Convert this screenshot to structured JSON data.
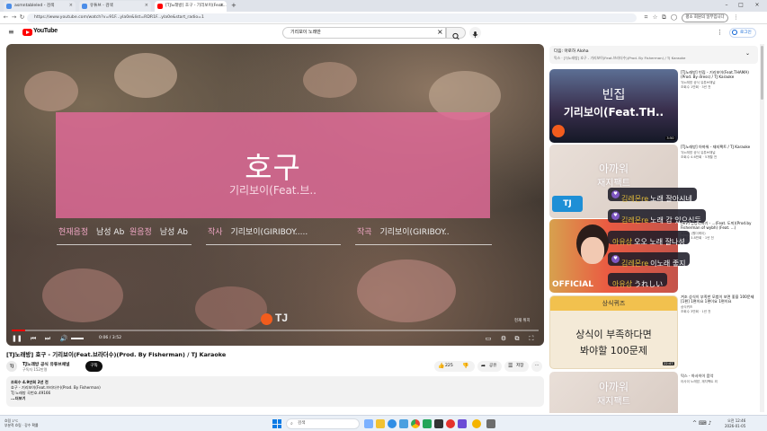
{
  "browser": {
    "tabs": [
      {
        "label": "asmntableled - 검색",
        "favicon_color": "#4b8de8",
        "active": false
      },
      {
        "label": "유튜브 - 검색",
        "favicon_color": "#4b8de8",
        "active": false
      },
      {
        "label": "[TJ노래방] 호구 - 기리보이(Feat...",
        "favicon_color": "#ff0000",
        "active": true
      }
    ],
    "new_tab_label": "+",
    "url": "https://www.youtube.com/watch?v=91F...yla0e&list=RDR1F...yla0e&start_radio=1",
    "profile_label": "평소 회원의 일부입니다"
  },
  "youtube": {
    "logo_text": "YouTube",
    "search_value": "기리보이 노래만",
    "login_label": "로그인"
  },
  "player": {
    "song_title": "호구",
    "song_artist": "기리보이(Feat.브..",
    "current_key_label": "현재음정",
    "current_key_value": "남성 Ab",
    "original_key_label": "원음정",
    "original_key_value": "남성 Ab",
    "lyricist_label": "작사",
    "lyricist_value": "기리보이(GIRIBOY.....",
    "composer_label": "작곡",
    "composer_value": "기리보이(GIRIBOY..",
    "brand": "TJ",
    "corner_label": "현재 위치",
    "time": "0:06 / 3:52",
    "progress_fraction": 0.026
  },
  "video": {
    "title": "[TJ노래방] 호구 - 기리보이(Feat.브라더수)(Prod. By Fisherman) / TJ Karaoke",
    "channel_avatar": "TJ",
    "channel_name": "TJ노래방 공식 유튜브채널",
    "channel_subs": "구독자 152만명",
    "subscribe_label": "구독",
    "like_count": "225",
    "share_label": "공유",
    "save_label": "저장",
    "description": [
      "조회수 4.9만회  2년 전",
      "호구 - 기리보이(Feat.브라더수)(Prod. By Fisherman)",
      "TJ 노래방 곡번호.49166",
      "...더보기"
    ]
  },
  "sidebar": {
    "up_next_title": "다음: 아로하 Aloha",
    "up_next_sub": "믹스 · [TJ노래방] 호구 - 기리보이(Feat.브라더수)(Prod. By Fisherman) / TJ Karaoke",
    "cards": [
      {
        "title": "[TJ노래방] 빈집 - 기리보이(Feat.THAMA)(Prod. By dress) / TJ Karaoke",
        "channel": "TJ노래방 공식 유튜브채널",
        "stats": "조회수 1만회 · 3년 전",
        "thumb_line1": "빈집",
        "thumb_line2": "기리보이(Feat.TH..",
        "duration": "3:50"
      },
      {
        "title": "[TJ노래방] 아까워 - 재지팩트 / TJ Karaoke",
        "channel": "TJ노래방 공식 유튜브채널",
        "stats": "조회수 4.6만회 · 5개월 전",
        "thumb_line1": "아까워",
        "thumb_line2": "재지팩트",
        "duration": ""
      },
      {
        "title": "[MV] 상상더하기 - ...(Feat. 도끼)(Prod.by Fisherman of wybh) (Feat. ...)",
        "channel": "1theK (원더케이)",
        "stats": "조회수 3.8만회 · 1년 전",
        "thumb_line1": "OFFICIAL",
        "thumb_line2": "",
        "duration": ""
      },
      {
        "title": "겨조 상식이 부족한 모범이 보면 좋을 100문제 [1편] 1편이요 1편이요 1편이요",
        "channel": "상식퀴즈",
        "stats": "조회수 3만회 · 1년 전",
        "thumb_line1": "상식이 부족하다면",
        "thumb_line2": "봐야할 100문제",
        "thumb_tag": "상식퀴즈",
        "duration": "22:47"
      },
      {
        "title": "믹스 - 아사이이 음악",
        "channel": "아사이 노래방, 재지팩트 외",
        "stats": "",
        "thumb_line1": "아까워",
        "thumb_line2": "재지팩트",
        "duration": ""
      }
    ]
  },
  "chat": [
    {
      "nick": "김레몬re",
      "msg": "노래 잘아시네",
      "heart": true
    },
    {
      "nick": "김레몬re",
      "msg": "노래 감 있으신듯",
      "heart": true
    },
    {
      "nick": "아유상",
      "msg": "오오 노래 잘나셩",
      "heart": false
    },
    {
      "nick": "김레몬re",
      "msg": "이노래 좋지",
      "heart": true
    },
    {
      "nick": "아유상",
      "msg": "うれしい",
      "heart": false
    }
  ],
  "taskbar": {
    "weather_line1": "흐림 1°C",
    "weather_line2": "부분적 흐림 · 강수 확률",
    "search_placeholder": "검색",
    "time": "오전 12:46",
    "date": "2026-01-05"
  },
  "colors": {
    "yt_red": "#ff0000",
    "title_card_pink": "#e26a98",
    "meta_label_pink": "#f0a6c4",
    "chat_nick_gold": "#e3bd3a",
    "chat_heart_purple": "#7e57c2",
    "link_blue": "#065fd4"
  }
}
